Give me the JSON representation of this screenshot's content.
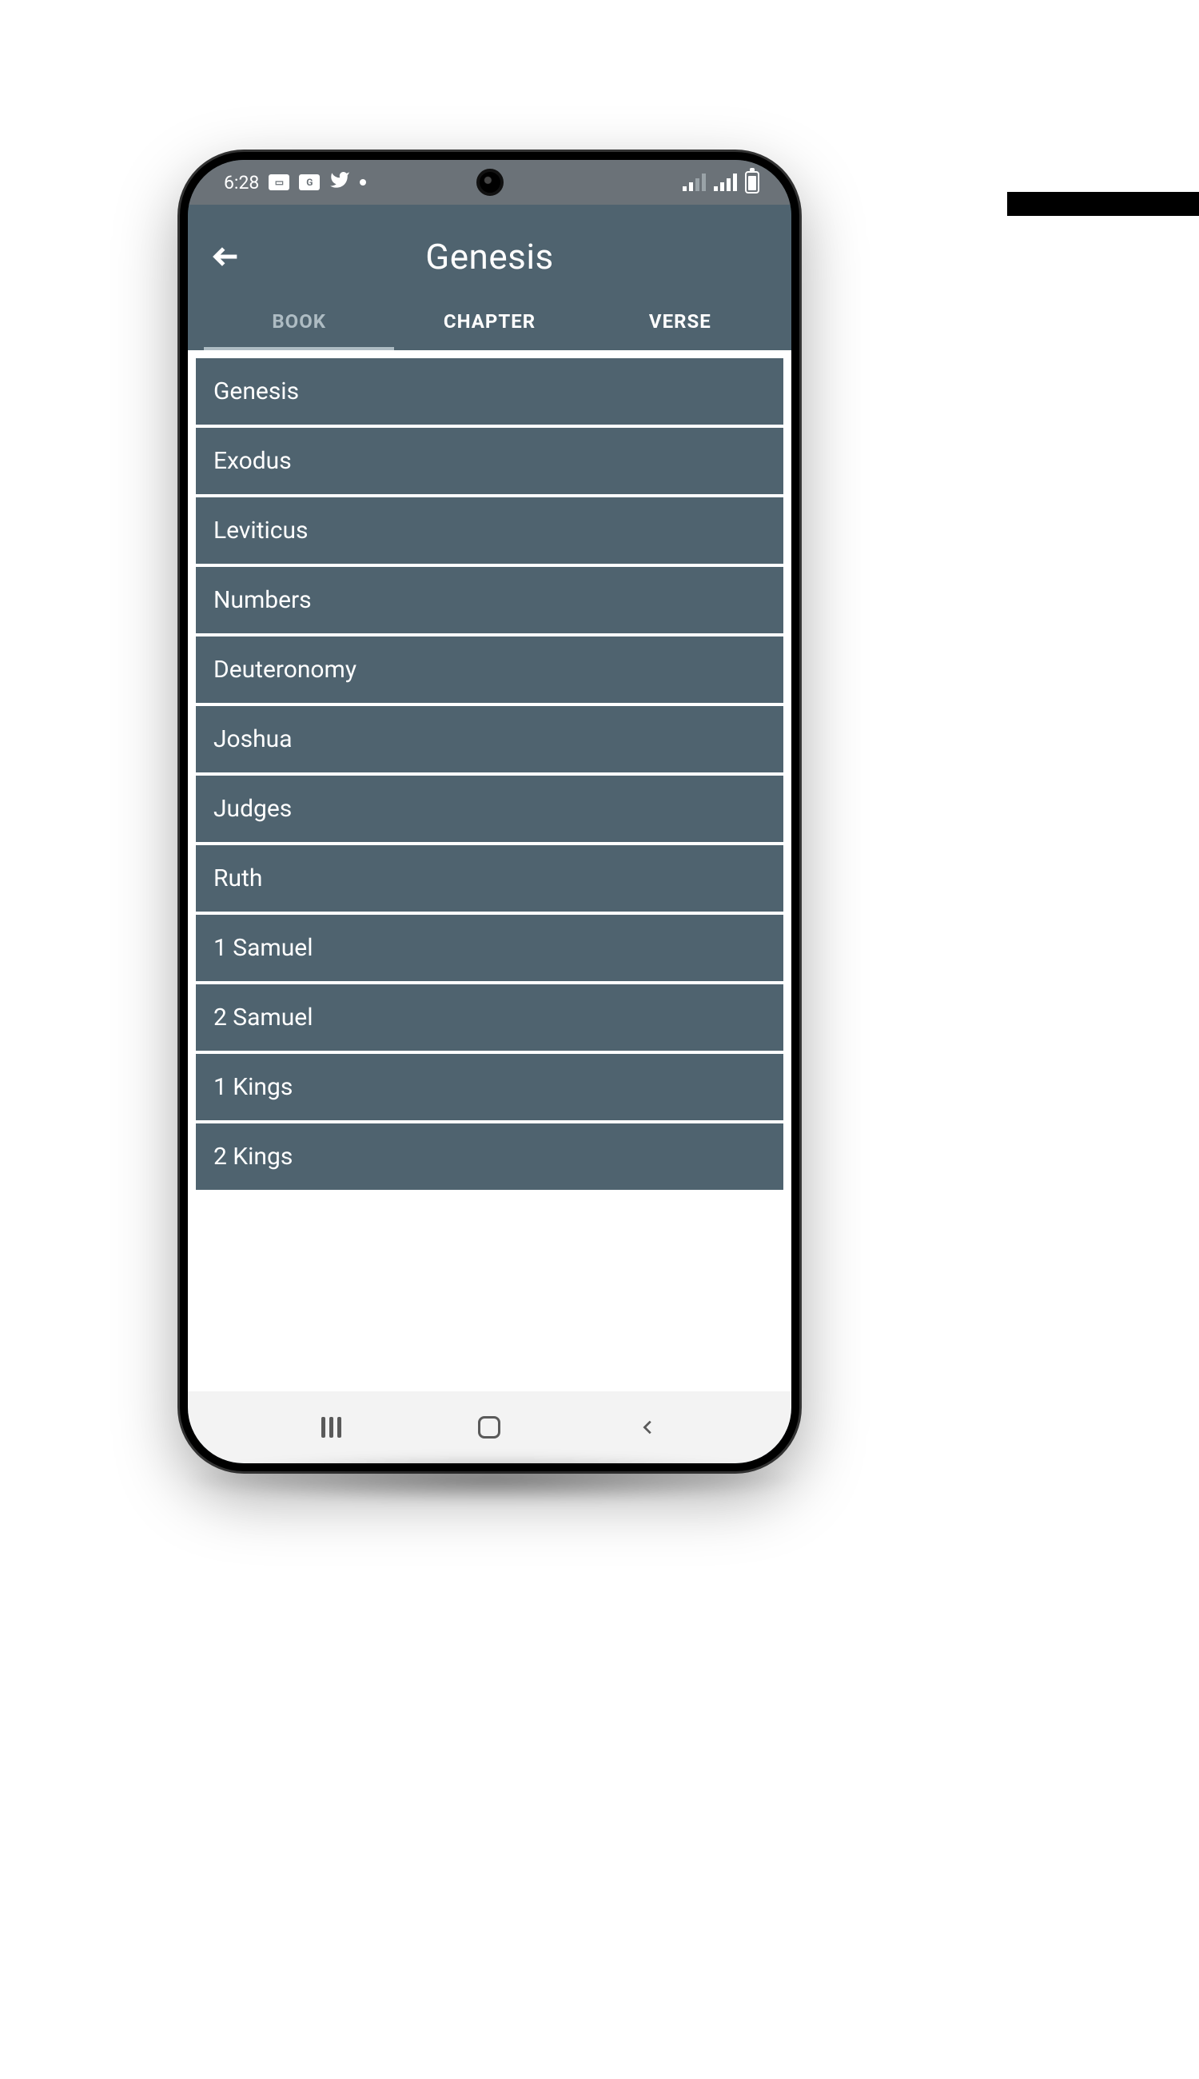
{
  "status": {
    "time": "6:28",
    "icons": [
      "image-icon",
      "google-news-icon",
      "twitter-icon",
      "dot-icon"
    ]
  },
  "header": {
    "title": "Genesis"
  },
  "tabs": [
    {
      "label": "BOOK",
      "active": true
    },
    {
      "label": "CHAPTER",
      "active": false
    },
    {
      "label": "VERSE",
      "active": false
    }
  ],
  "books": [
    "Genesis",
    "Exodus",
    "Leviticus",
    "Numbers",
    "Deuteronomy",
    "Joshua",
    "Judges",
    "Ruth",
    "1 Samuel",
    "2 Samuel",
    "1 Kings",
    "2 Kings"
  ],
  "colors": {
    "app_bg": "#4f636f",
    "status_bg": "#6b7278"
  }
}
